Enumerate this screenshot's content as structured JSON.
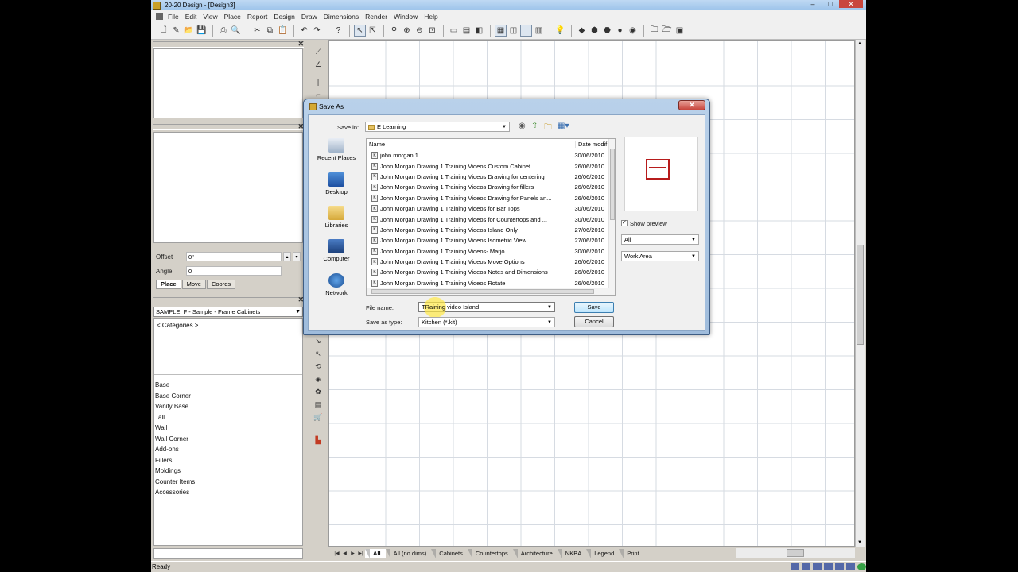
{
  "app": {
    "title": "20-20 Design - [Design3]",
    "window_controls": [
      "–",
      "□",
      "✕"
    ]
  },
  "menu": [
    "File",
    "Edit",
    "View",
    "Place",
    "Report",
    "Design",
    "Draw",
    "Dimensions",
    "Render",
    "Window",
    "Help"
  ],
  "left_panel": {
    "offset_label": "Offset",
    "offset_value": "0\"",
    "angle_label": "Angle",
    "angle_value": "0",
    "tabs": [
      "Place",
      "Move",
      "Coords"
    ],
    "catalog_select": "SAMPLE_F - Sample - Frame Cabinets",
    "categories_header": "< Categories >",
    "categories": [
      "Base",
      "Base Corner",
      "Vanity Base",
      "Tall",
      "Wall",
      "Wall Corner",
      "Add-ons",
      "Fillers",
      "Moldings",
      "Counter Items",
      "Accessories"
    ]
  },
  "sheet_tabs": [
    "All",
    "All (no dims)",
    "Cabinets",
    "Countertops",
    "Architecture",
    "NKBA",
    "Legend",
    "Print"
  ],
  "status": {
    "text": "Ready"
  },
  "dialog": {
    "title": "Save As",
    "close_label": "✕",
    "save_in_label": "Save in:",
    "save_in_value": "E Learning",
    "places": [
      "Recent Places",
      "Desktop",
      "Libraries",
      "Computer",
      "Network"
    ],
    "columns": {
      "name": "Name",
      "date": "Date modif"
    },
    "files": [
      {
        "name": "john morgan 1",
        "date": "30/06/2010"
      },
      {
        "name": "John Morgan Drawing 1 Training Videos Custom Cabinet",
        "date": "26/06/2010"
      },
      {
        "name": "John Morgan Drawing 1 Training Videos Drawing for centering",
        "date": "26/06/2010"
      },
      {
        "name": "John Morgan Drawing 1 Training Videos Drawing for fillers",
        "date": "26/06/2010"
      },
      {
        "name": "John Morgan Drawing 1 Training Videos Drawing for Panels an...",
        "date": "26/06/2010"
      },
      {
        "name": "John Morgan Drawing 1 Training Videos for Bar Tops",
        "date": "30/06/2010"
      },
      {
        "name": "John Morgan Drawing 1 Training Videos for Countertops and ...",
        "date": "30/06/2010"
      },
      {
        "name": "John Morgan Drawing 1 Training Videos Island Only",
        "date": "27/06/2010"
      },
      {
        "name": "John Morgan Drawing 1 Training Videos Isometric View",
        "date": "27/06/2010"
      },
      {
        "name": "John Morgan Drawing 1 Training Videos- Marjo",
        "date": "30/06/2010"
      },
      {
        "name": "John Morgan Drawing 1 Training Videos Move Options",
        "date": "26/06/2010"
      },
      {
        "name": "John Morgan Drawing 1 Training Videos Notes and Dimensions",
        "date": "26/06/2010"
      },
      {
        "name": "John Morgan Drawing 1 Training Videos Rotate",
        "date": "26/06/2010"
      }
    ],
    "show_preview_label": "Show preview",
    "show_preview_checked": true,
    "filter_all": "All",
    "filter_area": "Work Area",
    "file_name_label": "File name:",
    "file_name_value": "TRaining video Island",
    "save_as_type_label": "Save as type:",
    "save_as_type_value": "Kitchen (*.kit)",
    "save_button": "Save",
    "cancel_button": "Cancel"
  }
}
